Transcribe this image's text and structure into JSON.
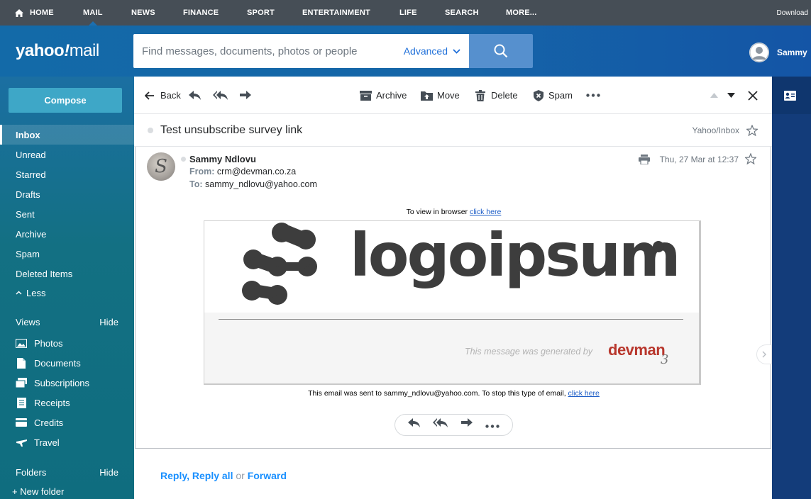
{
  "top_nav": {
    "items": [
      "HOME",
      "MAIL",
      "NEWS",
      "FINANCE",
      "SPORT",
      "ENTERTAINMENT",
      "LIFE",
      "SEARCH",
      "MORE..."
    ],
    "download": "Download"
  },
  "header": {
    "logo_text": "yahoo",
    "logo_bang": "!",
    "logo_mail": "mail",
    "search_placeholder": "Find messages, documents, photos or people",
    "advanced_label": "Advanced",
    "user_name": "Sammy"
  },
  "sidebar": {
    "compose_label": "Compose",
    "folders": [
      "Inbox",
      "Unread",
      "Starred",
      "Drafts",
      "Sent",
      "Archive",
      "Spam",
      "Deleted Items"
    ],
    "less_label": "Less",
    "views_label": "Views",
    "views_hide": "Hide",
    "views": [
      {
        "label": "Photos",
        "icon": "photo-icon"
      },
      {
        "label": "Documents",
        "icon": "document-icon"
      },
      {
        "label": "Subscriptions",
        "icon": "subscriptions-icon"
      },
      {
        "label": "Receipts",
        "icon": "receipt-icon"
      },
      {
        "label": "Credits",
        "icon": "credit-card-icon"
      },
      {
        "label": "Travel",
        "icon": "plane-icon"
      }
    ],
    "folders_label": "Folders",
    "folders_hide": "Hide",
    "new_folder": "New folder"
  },
  "toolbar": {
    "back": "Back",
    "archive": "Archive",
    "move": "Move",
    "delete": "Delete",
    "spam": "Spam"
  },
  "message": {
    "subject": "Test unsubscribe survey link",
    "folder_path": "Yahoo/Inbox",
    "sender_name": "Sammy Ndlovu",
    "from_label": "From:",
    "from_value": "crm@devman.co.za",
    "to_label": "To:",
    "to_value": "sammy_ndlovu@yahoo.com",
    "date": "Thu, 27 Mar at 12:37",
    "avatar_letter": "S"
  },
  "email_body": {
    "view_browser_text": "To view in browser",
    "view_browser_link": "click here",
    "logo_text": "logoipsum",
    "generated_by": "This message was generated by",
    "devman_text": "devman",
    "unsub_text": "This email was sent to sammy_ndlovu@yahoo.com. To stop this type of email,",
    "unsub_link": "click here"
  },
  "reply_bar": {
    "reply": "Reply",
    "reply_all": "Reply all",
    "or": "or",
    "forward": "Forward"
  },
  "colors": {
    "top_nav_bg": "#464e56",
    "header_bg": "#1565a8",
    "search_button": "#5690ce",
    "compose_button": "#3ea7c7",
    "link_blue": "#188fff",
    "devman_red": "#b8372d"
  }
}
